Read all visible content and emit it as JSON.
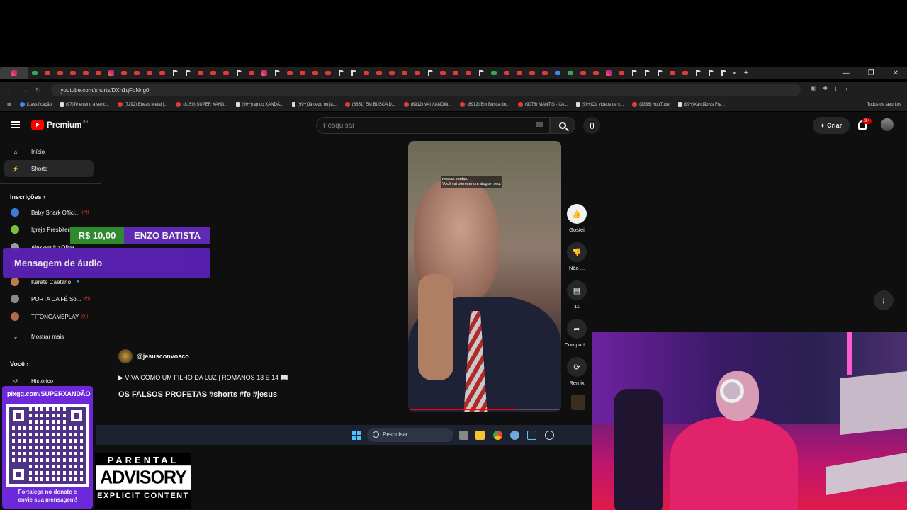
{
  "browser": {
    "url": "youtube.com/shorts/DXn1qFqNng0",
    "bookmarks": [
      {
        "label": "Classificação",
        "icon": "b"
      },
      {
        "label": "(97)Te ensino a venc...",
        "icon": "t"
      },
      {
        "label": "(7292) Enéas Metal |...",
        "icon": "r"
      },
      {
        "label": "(8159) SUPER XAND...",
        "icon": "r"
      },
      {
        "label": "(99+)rap do XANDÃ...",
        "icon": "t"
      },
      {
        "label": "(99+)Já cedo ou já...",
        "icon": "t"
      },
      {
        "label": "(8851) EM BUSCA D...",
        "icon": "r"
      },
      {
        "label": "(8912) VAI XANDIN...",
        "icon": "r"
      },
      {
        "label": "(8912) Em Busca do...",
        "icon": "r"
      },
      {
        "label": "(9078) MANTIS - XA...",
        "icon": "r"
      },
      {
        "label": "(99+)Os vídeos de c...",
        "icon": "t"
      },
      {
        "label": "(9338) YouTube",
        "icon": "r"
      },
      {
        "label": "(99+)Xandão vs Fra...",
        "icon": "t"
      }
    ],
    "all_bookmarks": "Todos os favoritos"
  },
  "youtube": {
    "logo_text": "Premium",
    "logo_region": "BR",
    "search_placeholder": "Pesquisar",
    "create_label": "Criar",
    "notif_badge": "9+",
    "sidebar": {
      "home": "Início",
      "shorts": "Shorts",
      "subs_title": "Inscrições",
      "subs": [
        {
          "name": "Baby Shark Offici...",
          "color": "#3d7bd9",
          "live": true
        },
        {
          "name": "Igreja Presbiteria...",
          "color": "#7bbf3f",
          "live": false
        },
        {
          "name": "Alexsandro Olive...",
          "color": "#9a9aa8",
          "live": false
        },
        {
          "name": "",
          "color": "#b4a0c8",
          "live": false
        },
        {
          "name": "Karate Caetano",
          "color": "#c07a50",
          "live": false,
          "dot": true
        },
        {
          "name": "PORTA DA FÉ So...",
          "color": "#8a8a8a",
          "live": true
        },
        {
          "name": "TITONGAMEPLAY",
          "color": "#b06a4a",
          "live": true
        }
      ],
      "show_more": "Mostrar mais",
      "you_title": "Você",
      "history": "Histórico"
    },
    "short": {
      "caption_line1": "nossas contas.",
      "caption_line2": "Você vai oferecer um aluguel seu.",
      "channel": "@jesusconvosco",
      "description": "▶ VIVA COMO UM FILHO DA LUZ | ROMANOS 13 E 14 📖",
      "title": "OS FALSOS PROFETAS #shorts #fe #jesus",
      "progress": 0.7
    },
    "actions": {
      "like": "Gostei",
      "dislike": "Não ...",
      "comments": "11",
      "share": "Compart...",
      "remix": "Remix"
    }
  },
  "overlay": {
    "donation_amount": "R$ 10,00",
    "donor": "ENZO BATISTA",
    "audio_message": "Mensagem de áudio",
    "pix_url": "pixgg.com/SUPERXANDÃO",
    "pix_cta_line1": "Fortaleça no donate e",
    "pix_cta_line2": "envie sua mensagem!",
    "pa_line1": "PARENTAL",
    "pa_line2": "ADVISORY",
    "pa_line3": "EXPLICIT CONTENT"
  },
  "taskbar": {
    "search": "Pesquisar"
  }
}
